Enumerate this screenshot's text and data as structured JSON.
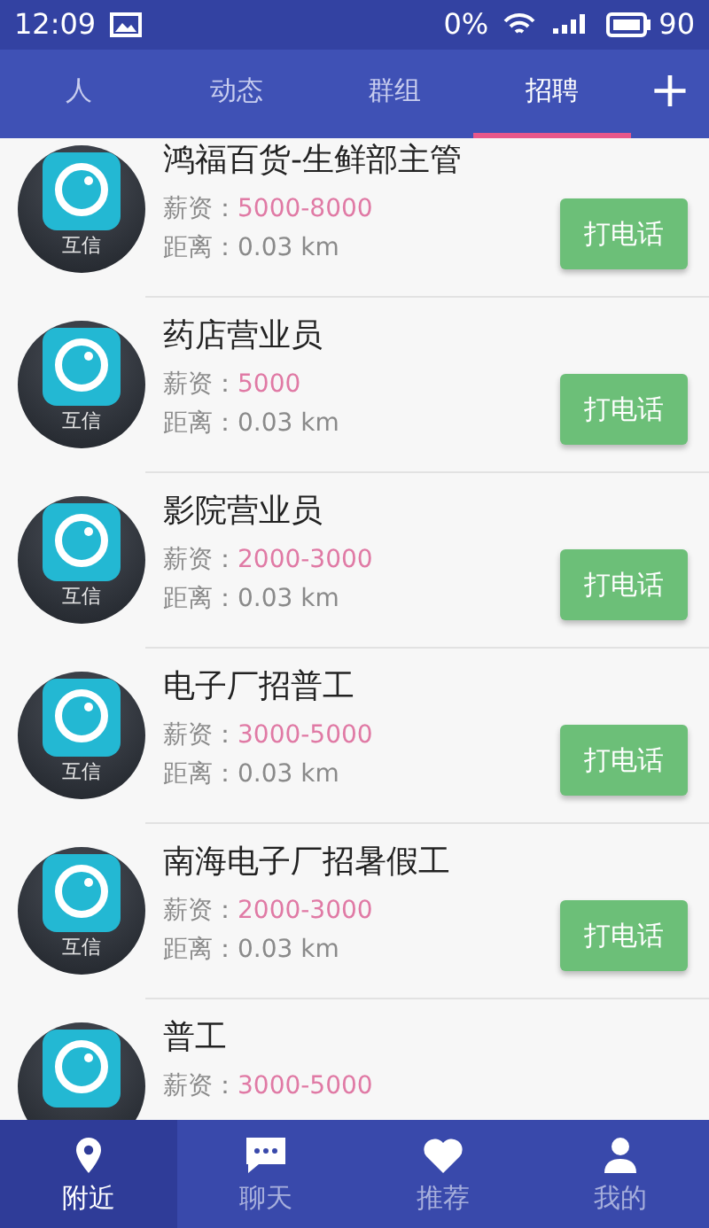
{
  "status_bar": {
    "time": "12:09",
    "data_rate": "0%",
    "battery": "90"
  },
  "tabs": [
    {
      "label": "人",
      "selected": false
    },
    {
      "label": "动态",
      "selected": false
    },
    {
      "label": "群组",
      "selected": false
    },
    {
      "label": "招聘",
      "selected": true
    }
  ],
  "add_button": "+",
  "jobs": [
    {
      "avatar_label": "互信",
      "title": "鸿福百货-生鲜部主管",
      "salary_label": "薪资：",
      "salary": "5000-8000",
      "distance_label": "距离：",
      "distance": "0.03 km",
      "button": "打电话"
    },
    {
      "avatar_label": "互信",
      "title": "药店营业员",
      "salary_label": "薪资：",
      "salary": "5000",
      "distance_label": "距离：",
      "distance": "0.03 km",
      "button": "打电话"
    },
    {
      "avatar_label": "互信",
      "title": "影院营业员",
      "salary_label": "薪资：",
      "salary": "2000-3000",
      "distance_label": "距离：",
      "distance": "0.03 km",
      "button": "打电话"
    },
    {
      "avatar_label": "互信",
      "title": "电子厂招普工",
      "salary_label": "薪资：",
      "salary": "3000-5000",
      "distance_label": "距离：",
      "distance": "0.03 km",
      "button": "打电话"
    },
    {
      "avatar_label": "互信",
      "title": "南海电子厂招暑假工",
      "salary_label": "薪资：",
      "salary": "2000-3000",
      "distance_label": "距离：",
      "distance": "0.03 km",
      "button": "打电话"
    },
    {
      "title": "普工",
      "salary_label": "薪资：",
      "salary": "3000-5000"
    }
  ],
  "bottom_nav": [
    {
      "label": "附近",
      "selected": true
    },
    {
      "label": "聊天",
      "selected": false
    },
    {
      "label": "推荐",
      "selected": false
    },
    {
      "label": "我的",
      "selected": false
    }
  ]
}
